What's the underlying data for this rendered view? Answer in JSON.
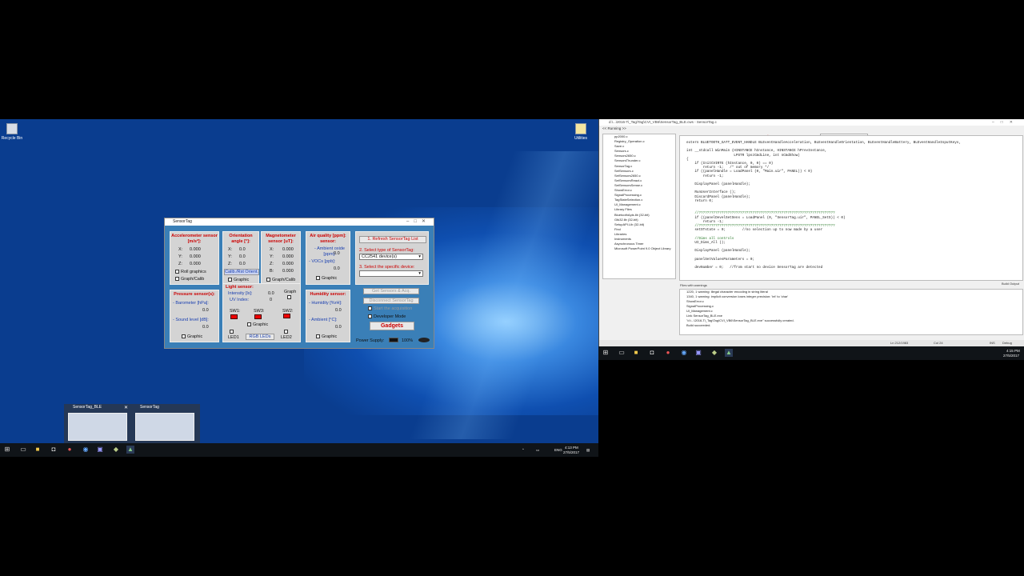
{
  "desktop": {
    "recycle_bin": "Recycle Bin",
    "utilities": "Utilities"
  },
  "sensortag_window": {
    "title": "SensorTag",
    "accel": {
      "header": "Accelerometer sensor [m/s²]:",
      "x_label": "X:",
      "x": "0.000",
      "y_label": "Y:",
      "y": "0.000",
      "z_label": "Z:",
      "z": "0.000",
      "roll": "Roll graphics",
      "graph": "Graph/Calib"
    },
    "orient": {
      "header": "Orientation angle [°]:",
      "x_label": "X:",
      "x": "0.0",
      "y_label": "Y:",
      "y": "0.0",
      "z_label": "Z:",
      "z": "0.0",
      "calib": "Calib./Rst Orient.",
      "graphic": "Graphic"
    },
    "magnet": {
      "header": "Magnetometer sensor [uT]:",
      "x_label": "X:",
      "x": "0.000",
      "y_label": "Y:",
      "y": "0.000",
      "z_label": "Z:",
      "z": "0.000",
      "b_label": "B:",
      "b": "0.000",
      "graph": "Graph/Calib"
    },
    "air": {
      "header": "Air quality [ppm]: sensor:",
      "co_label": "- Ambient oxide [ppm]:",
      "co": "0.0",
      "voc_label": "- VOCs [ppb]:",
      "voc": "0.0",
      "graphic": "Graphic"
    },
    "pressure": {
      "header": "Pressure sensor(s):",
      "baro_label": "- Barometer [hPa]:",
      "baro": "0.0",
      "sound_label": "- Sound level [dB]:",
      "sound": "0.0",
      "graphic": "Graphic"
    },
    "light": {
      "header": "Light sensor:",
      "int_label": "Intensity [lx]:",
      "int": "0.0",
      "uv_label": "UV Index:",
      "uv": "0",
      "graph": "Graph",
      "sw1": "SW1:",
      "sw3": "SW3:",
      "sw2": "SW2:",
      "graphic": "Graphic",
      "led1": "LED1",
      "rgb": "RGB LEDs",
      "led2": "LED2"
    },
    "humidity": {
      "header": "Humidity sensor:",
      "hum_label": "- Humidity [%rH]:",
      "hum": "0.0",
      "amb_label": "- Ambient [°C]:",
      "amb": "0.0",
      "graphic": "Graphic"
    },
    "control": {
      "refresh": "1. Refresh SensorTag List",
      "select_type": "2. Select type of SensorTag:",
      "type_value": "CC2541 device(s)",
      "select_device": "3. Select the specific device:",
      "get_sensors": "Get Sensors & Acq.",
      "disconnect": "Disconnect SensorTag",
      "start_acq": "Start the acquisition",
      "developer": "Developer Mode",
      "gadgets": "Gadgets",
      "power_label": "Power Supply:",
      "power_value": "100%"
    }
  },
  "thumbs": [
    {
      "title": "SensorTag_BLE"
    },
    {
      "title": "SensorTag"
    }
  ],
  "taskbar_left": {
    "lang": "ENG",
    "time": "4:13 PM",
    "date": "27/5/2017"
  },
  "ide": {
    "title": "d:\\...\\2016-Ti_Tag\\Tag\\CVI_VB6\\SensorTag_BLE.cws - SensorTag.c",
    "menu": "<< Running >>",
    "tabs": [
      "Main.uir",
      "SensorTag.c"
    ],
    "function_dd": "WinMain",
    "tree": [
      "pp2000.c",
      "Registry_Operation.c",
      "Save.c",
      "Sensors.c",
      "Sensors2650.c",
      "SensorsThunder.c",
      "SensorTag.c",
      "SetSensors.c",
      "SetSensors2650.c",
      "SetSensorsReact.c",
      "SetSensorsSense.c",
      "ShowError.c",
      "SignalProcessing.c",
      "TagStateSelection.c",
      "UI_Management.c",
      "Library Files",
      "BluetoothApis.lib (32-bit)",
      "Gtk32.lib (32-bit)",
      "SetupAPI.Lib (32-bit)",
      "",
      "",
      "Find",
      "",
      "Libraries",
      "Instruments",
      "Asynchronous Timer",
      "Microsoft PowerPoint 9.0 Object Library"
    ],
    "code": [
      "extern BLUETOOTH_GATT_EVENT_HANDLE BLEventHandleAcceleration, BLEventHandleOrientation, BLEventHandleBattery, BLEventHandleInputKeys,",
      "",
      "int __stdcall WinMain (HINSTANCE hInstance, HINSTANCE hPrevInstance,",
      "                       LPSTR lpszCmdLine, int nCmdShow)",
      "{",
      "    if (InitCVIRTE (hInstance, 0, 0) == 0)",
      "        return -1;   /* out of memory */",
      "    if ((panelHandle = LoadPanel (0, \"Main.uir\", PANEL)) < 0)",
      "        return -1;",
      "",
      "    DisplayPanel (panelHandle);",
      "",
      "    RunUserInterface ();",
      "    DiscardPanel (panelHandle);",
      "    return 0;",
      "",
      "",
      "    //??????????????????????????????????????????????????????????????????",
      "    if ((panelDevelSetSens = LoadPanel (0, \"SensorTag.uir\", PANEL_SetS)) < 0)",
      "        return -1;",
      "    //??????????????????????????????????????????????????????????????????",
      "    setSTstate = 0;        //no selection up to now made by a user",
      "",
      "    //Dims all controls",
      "    UI_Dims_All ();",
      "",
      "    DisplayPanel (panelHandle);",
      "",
      "    panelSetValuesParameters = 0;",
      "",
      "    devNumber = 0;   //from start no device SensorTag are detected"
    ],
    "build_header": "Build Output",
    "build_tab": "Files with warnings",
    "build": [
      "1220, 1   warning: illegal character encoding in string literal",
      "1340, 1   warning: implicit conversion loses integer precision: 'int' to 'char'",
      "ShowError.c",
      "SignalProcessing.c",
      "UI_Management.c",
      "Link SensorTag_BLE.exe",
      "\"d:\\...\\2016-Ti_Tag\\Tag\\CVI_VB6\\SensorTag_BLE.exe\" successfully created.",
      "Build succeeded."
    ],
    "status": {
      "pos": "Ln 212/1983",
      "col": "Col 24",
      "mode": "INS",
      "debug": "Debug"
    },
    "time": "4:15 PM",
    "date": "27/5/2017"
  }
}
